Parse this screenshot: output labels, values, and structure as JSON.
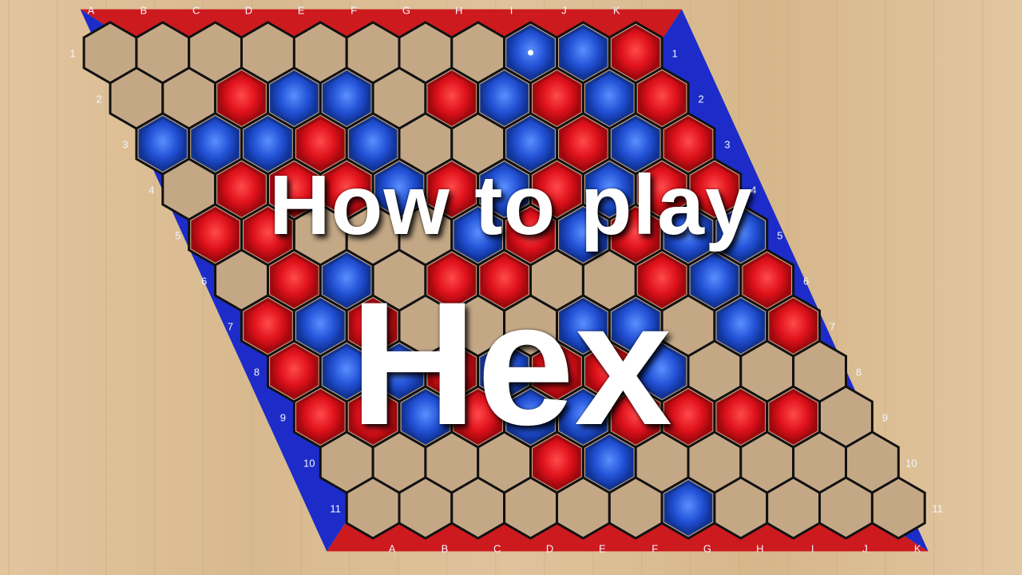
{
  "title": {
    "line1": "How to play",
    "line2": "Hex"
  },
  "board": {
    "size": 11,
    "column_labels": [
      "A",
      "B",
      "C",
      "D",
      "E",
      "F",
      "G",
      "H",
      "I",
      "J",
      "K"
    ],
    "row_labels": [
      "1",
      "2",
      "3",
      "4",
      "5",
      "6",
      "7",
      "8",
      "9",
      "10",
      "11"
    ],
    "rows": [
      "........BBR",
      "..RBB.RBRBR",
      "BBBRB..BRBR",
      ".RRRBRBRBRR",
      "RR...BRBRBB",
      ".RB.RR..RBR",
      "RBR...BB.BR",
      "RBBRBRRB...",
      "RRBRBBRRRR.",
      "....RB......",
      "......B...."
    ]
  },
  "colors": {
    "red": "#d4111b",
    "blue": "#1f4fd0",
    "edge_red": "#cc1a1f",
    "edge_blue": "#1d2cc8",
    "empty_cell": "#c4a886",
    "wood": "#dcbd92",
    "grid_line": "#111111"
  },
  "pieces": {
    "last_move_marker": "dot-icon"
  }
}
